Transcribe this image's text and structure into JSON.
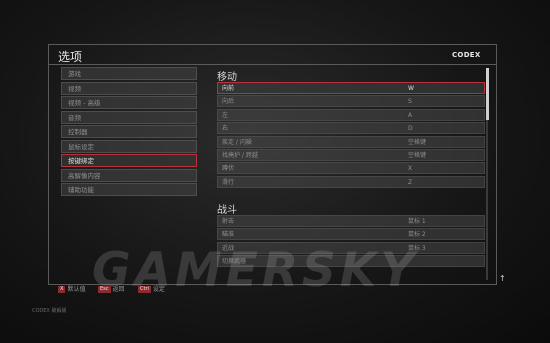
{
  "header": {
    "title": "选项",
    "brand": "CODEX"
  },
  "sidebar": {
    "items": [
      {
        "label": "游戏"
      },
      {
        "label": "视频"
      },
      {
        "label": "视频 - 高级"
      },
      {
        "label": "音频"
      },
      {
        "label": "控制器"
      },
      {
        "label": "鼠标设定"
      },
      {
        "label": "按键绑定",
        "active": true
      },
      {
        "label": "高解像内容"
      },
      {
        "label": "辅助功能"
      }
    ]
  },
  "sections": {
    "movement": {
      "title": "移动",
      "rows": [
        {
          "action": "向前",
          "key": "W",
          "active": true
        },
        {
          "action": "向后",
          "key": "S"
        },
        {
          "action": "左",
          "key": "A"
        },
        {
          "action": "右",
          "key": "D"
        },
        {
          "action": "疾走 / 闪躲",
          "key": "空格键"
        },
        {
          "action": "找掩护 / 跨越",
          "key": "空格键"
        },
        {
          "action": "蹲伏",
          "key": "X"
        },
        {
          "action": "滑行",
          "key": "Z"
        }
      ]
    },
    "combat": {
      "title": "战斗",
      "rows": [
        {
          "action": "射击",
          "key": "鼠标 1"
        },
        {
          "action": "瞄准",
          "key": "鼠标 2"
        },
        {
          "action": "近战",
          "key": "鼠标 3"
        },
        {
          "action": "切换武器",
          "key": ""
        }
      ]
    }
  },
  "footer": {
    "default": {
      "key": "X",
      "label": "默认值"
    },
    "back": {
      "key": "Esc",
      "label": "返回"
    },
    "settings": {
      "key": "Ctrl",
      "label": "设定"
    },
    "sub": "CODEX 破解版"
  },
  "watermark": "GAMERSKY",
  "colors": {
    "accent": "#b8323a",
    "panel": "#484848"
  }
}
